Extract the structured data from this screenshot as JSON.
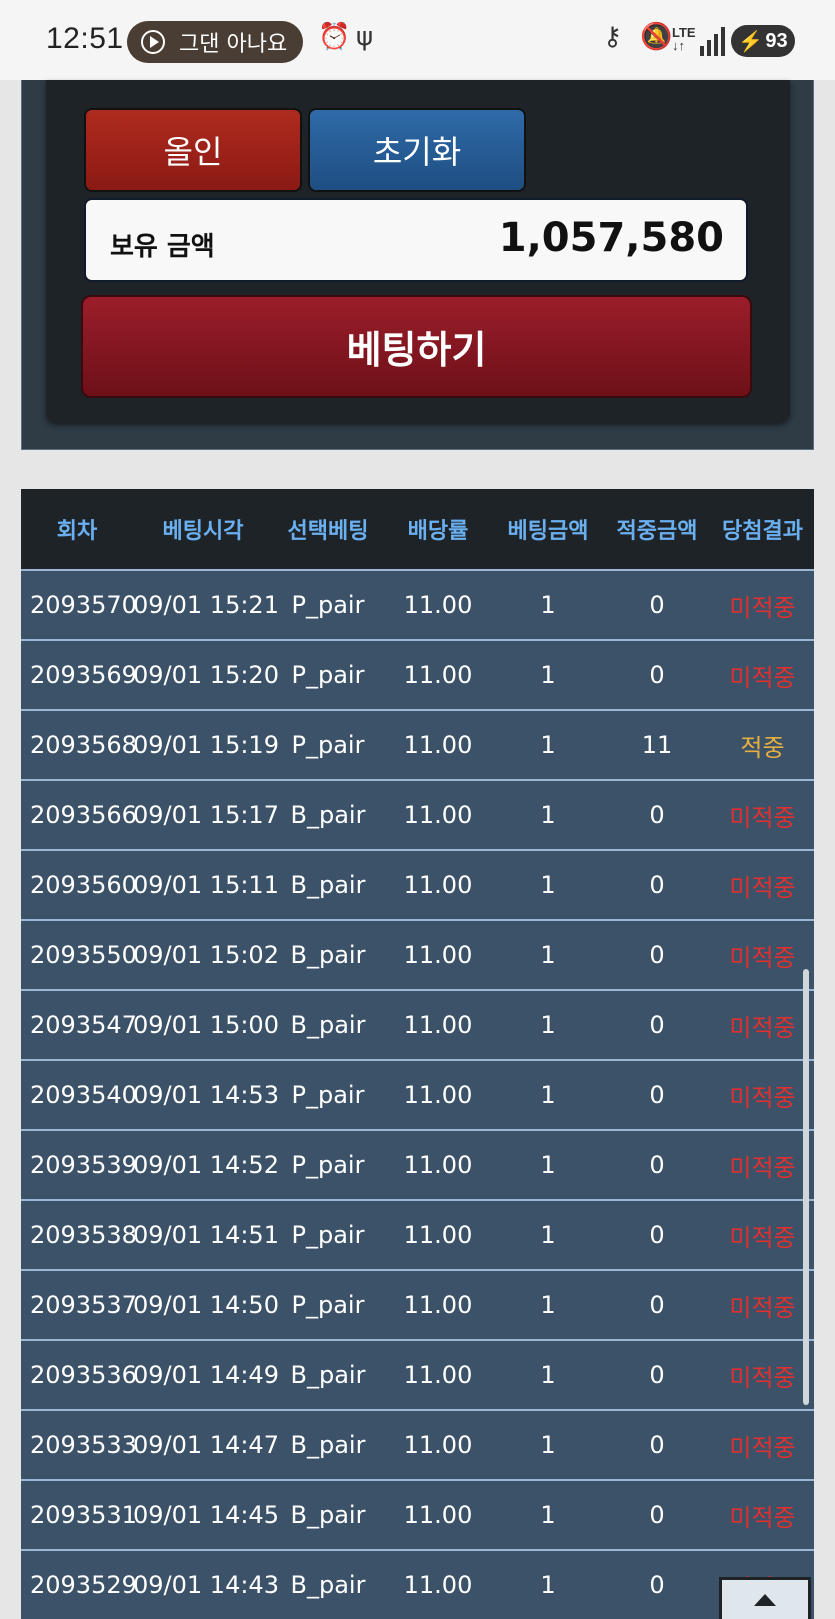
{
  "status_bar": {
    "time": "12:51",
    "media_pill": "그댄 아나요",
    "battery": "93",
    "network": "LTE",
    "icons": [
      "alarm-icon",
      "usb-icon",
      "key-icon",
      "mute-icon",
      "signal-icon",
      "battery-icon"
    ]
  },
  "bet_panel": {
    "allin_label": "올인",
    "reset_label": "초기화",
    "balance_label": "보유 금액",
    "balance_value": "1,057,580",
    "bet_label": "베팅하기"
  },
  "table": {
    "headers": [
      "회차",
      "베팅시각",
      "선택베팅",
      "배당률",
      "베팅금액",
      "적중금액",
      "당첨결과"
    ],
    "rows": [
      [
        "2093570",
        "09/01 15:21",
        "P_pair",
        "11.00",
        "1",
        "0",
        "미적중"
      ],
      [
        "2093569",
        "09/01 15:20",
        "P_pair",
        "11.00",
        "1",
        "0",
        "미적중"
      ],
      [
        "2093568",
        "09/01 15:19",
        "P_pair",
        "11.00",
        "1",
        "11",
        "적중"
      ],
      [
        "2093566",
        "09/01 15:17",
        "B_pair",
        "11.00",
        "1",
        "0",
        "미적중"
      ],
      [
        "2093560",
        "09/01 15:11",
        "B_pair",
        "11.00",
        "1",
        "0",
        "미적중"
      ],
      [
        "2093550",
        "09/01 15:02",
        "B_pair",
        "11.00",
        "1",
        "0",
        "미적중"
      ],
      [
        "2093547",
        "09/01 15:00",
        "B_pair",
        "11.00",
        "1",
        "0",
        "미적중"
      ],
      [
        "2093540",
        "09/01 14:53",
        "P_pair",
        "11.00",
        "1",
        "0",
        "미적중"
      ],
      [
        "2093539",
        "09/01 14:52",
        "P_pair",
        "11.00",
        "1",
        "0",
        "미적중"
      ],
      [
        "2093538",
        "09/01 14:51",
        "P_pair",
        "11.00",
        "1",
        "0",
        "미적중"
      ],
      [
        "2093537",
        "09/01 14:50",
        "P_pair",
        "11.00",
        "1",
        "0",
        "미적중"
      ],
      [
        "2093536",
        "09/01 14:49",
        "B_pair",
        "11.00",
        "1",
        "0",
        "미적중"
      ],
      [
        "2093533",
        "09/01 14:47",
        "B_pair",
        "11.00",
        "1",
        "0",
        "미적중"
      ],
      [
        "2093531",
        "09/01 14:45",
        "B_pair",
        "11.00",
        "1",
        "0",
        "미적중"
      ],
      [
        "2093529",
        "09/01 14:43",
        "B_pair",
        "11.00",
        "1",
        "0",
        "미적중"
      ]
    ]
  },
  "colors": {
    "miss": "#e03030",
    "hit": "#e6b040",
    "header_text": "#6ab0f0"
  }
}
